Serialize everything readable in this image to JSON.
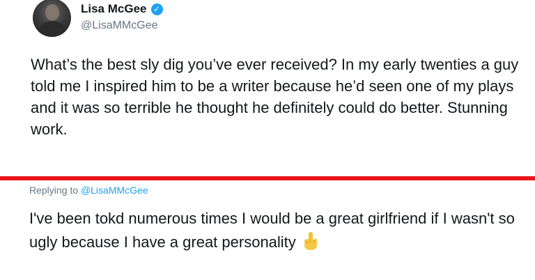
{
  "tweet": {
    "author_name": "Lisa McGee",
    "handle": "@LisaMMcGee",
    "verified_icon": "verified-badge-icon",
    "text": "What’s the best sly dig you’ve ever received? In my early twenties a guy told me I inspired him to be a writer because he’d seen one of my plays and it was so terrible he thought he definitely could do better. Stunning work."
  },
  "divider": {
    "color": "#e8161b"
  },
  "reply": {
    "replying_prefix": "Replying to",
    "replying_handle": "@LisaMMcGee",
    "text": "I've been tokd numerous times I would be a great girlfriend if I wasn't so ugly because I have a great personality",
    "emoji_icon": "middle-finger-icon"
  },
  "colors": {
    "accent": "#1da1f2",
    "secondary_text": "#657786",
    "primary_text": "#14171a"
  }
}
